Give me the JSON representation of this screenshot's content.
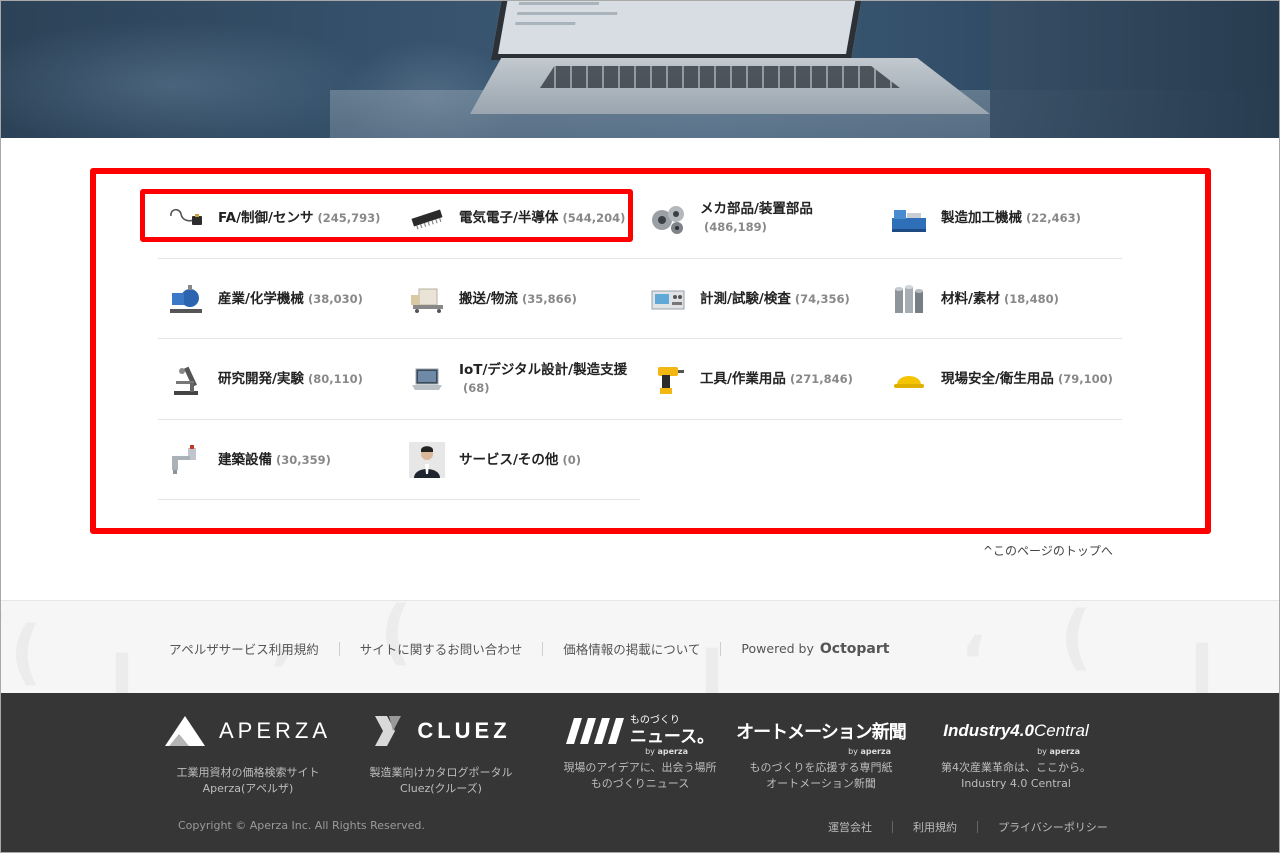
{
  "categories": [
    [
      {
        "label": "FA/制御/センサ",
        "count": "(245,793)",
        "icon": "sensor-cable-icon"
      },
      {
        "label": "電気電子/半導体",
        "count": "(544,204)",
        "icon": "semiconductor-chip-icon"
      },
      {
        "label": "メカ部品/装置部品",
        "count": "(486,189)",
        "icon": "bearing-icon"
      },
      {
        "label": "製造加工機械",
        "count": "(22,463)",
        "icon": "lathe-machine-icon"
      }
    ],
    [
      {
        "label": "産業/化学機械",
        "count": "(38,030)",
        "icon": "pump-icon"
      },
      {
        "label": "搬送/物流",
        "count": "(35,866)",
        "icon": "conveyor-box-icon"
      },
      {
        "label": "計測/試験/検査",
        "count": "(74,356)",
        "icon": "measuring-instrument-icon"
      },
      {
        "label": "材料/素材",
        "count": "(18,480)",
        "icon": "metal-pipes-icon"
      }
    ],
    [
      {
        "label": "研究開発/実験",
        "count": "(80,110)",
        "icon": "microscope-icon"
      },
      {
        "label": "IoT/デジタル設計/製造支援",
        "count": "(68)",
        "icon": "laptop-icon"
      },
      {
        "label": "工具/作業用品",
        "count": "(271,846)",
        "icon": "power-drill-icon"
      },
      {
        "label": "現場安全/衛生用品",
        "count": "(79,100)",
        "icon": "hard-hat-icon"
      }
    ],
    [
      {
        "label": "建築設備",
        "count": "(30,359)",
        "icon": "faucet-icon"
      },
      {
        "label": "サービス/その他",
        "count": "(0)",
        "icon": "businessman-icon"
      }
    ]
  ],
  "to_top": "^このページのトップへ",
  "footer_links": {
    "terms": "アペルザサービス利用規約",
    "contact": "サイトに関するお問い合わせ",
    "pricing": "価格情報の掲載について",
    "powered_by": "Powered by",
    "octopart": "Octopart"
  },
  "brands": [
    {
      "name": "APERZA",
      "desc1": "工業用資材の価格検索サイト",
      "desc2": "Aperza(アペルザ)"
    },
    {
      "name": "CLUEZ",
      "desc1": "製造業向けカタログポータル",
      "desc2": "Cluez(クルーズ)"
    },
    {
      "name": "ものづくりニュース",
      "kana": "ものづくり",
      "main": "ニュース。",
      "by": "by",
      "by_brand": "aperza",
      "desc1": "現場のアイデアに、出会う場所",
      "desc2": "ものづくりニュース"
    },
    {
      "name": "オートメーション新聞",
      "by": "by",
      "by_brand": "aperza",
      "desc1": "ものづくりを応援する専門紙",
      "desc2": "オートメーション新聞"
    },
    {
      "name": "Industry4.0Central",
      "name_a": "Industry4.0",
      "name_b": "Central",
      "by": "by",
      "by_brand": "aperza",
      "desc1": "第4次産業革命は、ここから。",
      "desc2": "Industry 4.0 Central"
    }
  ],
  "copyright": "Copyright © Aperza Inc. All Rights Reserved.",
  "bottom_links": {
    "company": "運営会社",
    "terms": "利用規約",
    "privacy": "プライバシーポリシー"
  }
}
